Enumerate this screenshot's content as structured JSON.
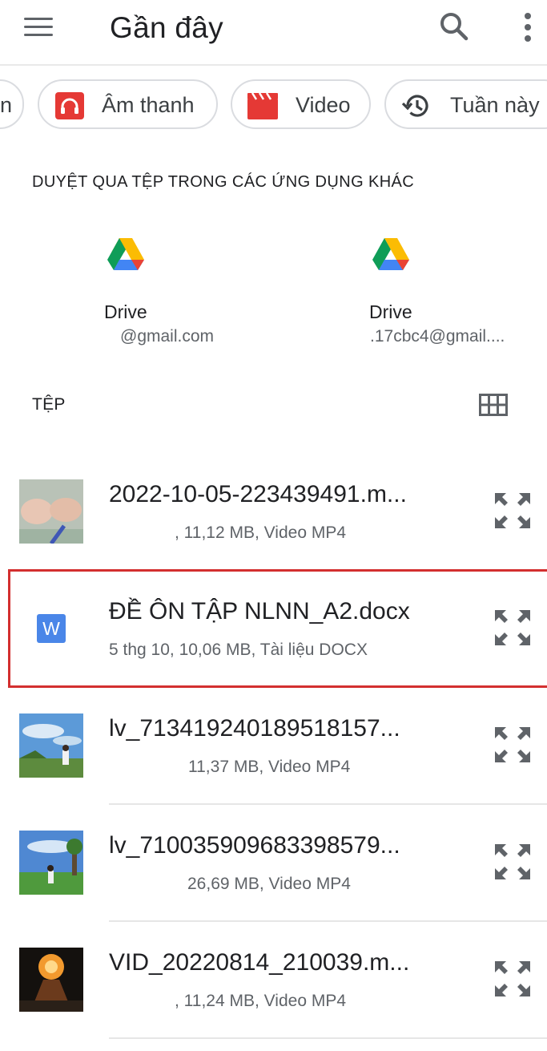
{
  "header": {
    "title": "Gần đây",
    "menu_icon": "menu-icon",
    "search_icon": "search-icon",
    "more_icon": "more-vert-icon"
  },
  "chips": [
    {
      "label": "n",
      "icon": ""
    },
    {
      "label": "Âm thanh",
      "icon": "headphones-icon"
    },
    {
      "label": "Video",
      "icon": "clapperboard-icon"
    },
    {
      "label": "Tuần này",
      "icon": "history-icon"
    }
  ],
  "browse_section": {
    "heading": "DUYỆT QUA TỆP TRONG CÁC ỨNG DỤNG KHÁC",
    "apps": [
      {
        "name": "Drive",
        "account": "@gmail.com",
        "icon": "google-drive-icon"
      },
      {
        "name": "Drive",
        "account": ".17cbc4@gmail....",
        "icon": "google-drive-icon"
      }
    ]
  },
  "files_section": {
    "heading": "TỆP",
    "grid_icon": "grid-view-icon",
    "items": [
      {
        "name": "2022-10-05-223439491.m...",
        "meta": ", 11,12 MB, Video MP4",
        "thumb": "video-thumbnail"
      },
      {
        "name": "ĐỀ ÔN TẬP NLNN_A2.docx",
        "meta": "5 thg 10, 10,06 MB, Tài liệu DOCX",
        "thumb": "word-doc-icon",
        "word_letter": "W"
      },
      {
        "name": "lv_713419240189518157...",
        "meta": "11,37 MB, Video MP4",
        "thumb": "video-thumbnail"
      },
      {
        "name": "lv_710035909683398579...",
        "meta": "26,69 MB, Video MP4",
        "thumb": "video-thumbnail"
      },
      {
        "name": "VID_20220814_210039.m...",
        "meta": ", 11,24 MB, Video MP4",
        "thumb": "video-thumbnail"
      }
    ]
  },
  "colors": {
    "accent_red": "#d32f2f",
    "word_blue": "#4a86e8",
    "text_primary": "#202124",
    "text_secondary": "#5f6368"
  }
}
